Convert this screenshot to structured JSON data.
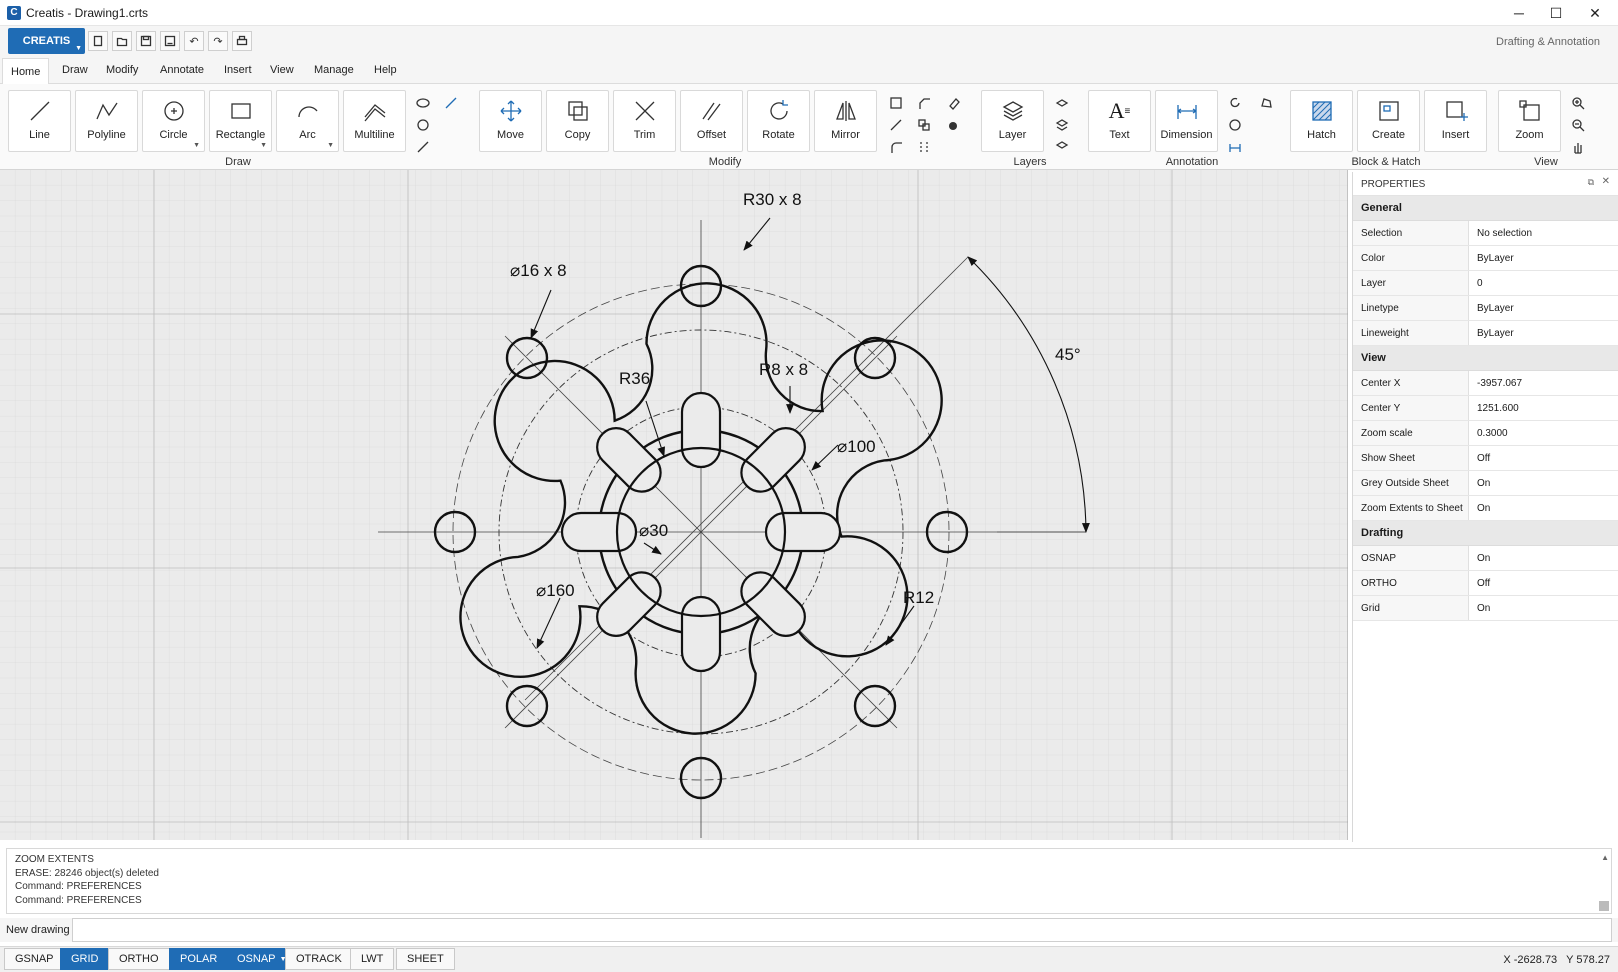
{
  "window": {
    "title": "Creatis - Drawing1.crts",
    "logo": "C",
    "minimize_icon": "minimize-icon",
    "maximize_icon": "maximize-icon",
    "close_icon": "close-icon"
  },
  "quickbar": {
    "app_button": "CREATIS",
    "workspace": "Drafting & Annotation",
    "tools": [
      "new-icon",
      "open-icon",
      "save-icon",
      "save-as-icon",
      "undo-icon",
      "redo-icon",
      "print-icon"
    ]
  },
  "menu": {
    "items": [
      "Home",
      "Draw",
      "Modify",
      "Annotate",
      "Insert",
      "View",
      "Manage",
      "Help"
    ],
    "active": "Home"
  },
  "ribbon": {
    "draw": {
      "group": "Draw",
      "line": "Line",
      "polyline": "Polyline",
      "circle": "Circle",
      "rectangle": "Rectangle",
      "arc": "Arc",
      "multiline": "Multiline"
    },
    "modify": {
      "group": "Modify",
      "move": "Move",
      "copy": "Copy",
      "trim": "Trim",
      "offset": "Offset",
      "rotate": "Rotate",
      "mirror": "Mirror"
    },
    "layers": {
      "group": "Layers",
      "layer": "Layer"
    },
    "annotation": {
      "group": "Annotation",
      "text": "Text",
      "dimension": "Dimension"
    },
    "block": {
      "group": "Block & Hatch",
      "hatch": "Hatch",
      "create": "Create",
      "insert": "Insert"
    },
    "view": {
      "group": "View",
      "zoom": "Zoom"
    }
  },
  "drawing": {
    "labels": {
      "r30": "R30 x 8",
      "d16": "⌀16 x 8",
      "r36": "R36",
      "r8": "R8 x 8",
      "d100": "⌀100",
      "d30": "⌀30",
      "d160": "⌀160",
      "r12": "R12",
      "angle": "45°"
    }
  },
  "properties": {
    "title": "PROPERTIES",
    "general": {
      "title": "General",
      "rows": [
        [
          "Selection",
          "No selection"
        ],
        [
          "Color",
          "ByLayer"
        ],
        [
          "Layer",
          "0"
        ],
        [
          "Linetype",
          "ByLayer"
        ],
        [
          "Lineweight",
          "ByLayer"
        ]
      ]
    },
    "view": {
      "title": "View",
      "rows": [
        [
          "Center X",
          "-3957.067"
        ],
        [
          "Center Y",
          "1251.600"
        ],
        [
          "Zoom scale",
          "0.3000"
        ],
        [
          "Show Sheet",
          "Off"
        ],
        [
          "Grey Outside Sheet",
          "On"
        ],
        [
          "Zoom Extents to Sheet",
          "On"
        ]
      ]
    },
    "drafting": {
      "title": "Drafting",
      "rows": [
        [
          "OSNAP",
          "On"
        ],
        [
          "ORTHO",
          "Off"
        ],
        [
          "Grid",
          "On"
        ]
      ]
    }
  },
  "command": {
    "history": [
      "ZOOM EXTENTS",
      "ERASE: 28246 object(s) deleted",
      "Command: PREFERENCES",
      "Command: PREFERENCES"
    ],
    "label": "New drawing"
  },
  "status": {
    "buttons": [
      {
        "label": "GSNAP",
        "on": false
      },
      {
        "label": "GRID",
        "on": true
      },
      {
        "label": "ORTHO",
        "on": false
      },
      {
        "label": "POLAR",
        "on": true
      },
      {
        "label": "OSNAP",
        "on": true
      },
      {
        "label": "OTRACK",
        "on": false
      },
      {
        "label": "LWT",
        "on": false
      },
      {
        "label": "SHEET",
        "on": false
      }
    ],
    "coords": "X -2628.73   Y 578.27"
  },
  "colors": {
    "accent": "#1f6cb5"
  }
}
